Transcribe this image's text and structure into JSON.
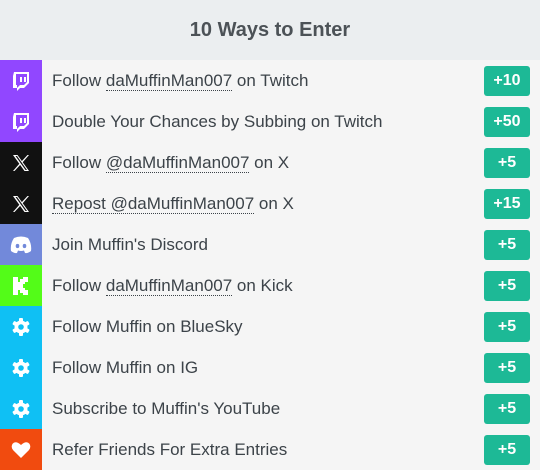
{
  "header": {
    "title": "10 Ways to Enter"
  },
  "colors": {
    "points_badge": "#1db996",
    "twitch": "#9147ff",
    "x": "#111111",
    "discord": "#7289da",
    "kick": "#53fc18",
    "bluesky": "#0fc0f4",
    "heart": "#f14b0f"
  },
  "entries": [
    {
      "label_pre": "Follow ",
      "label_link": "daMuffinMan007",
      "label_post": " on Twitch",
      "points": "+10",
      "icon": "twitch-icon"
    },
    {
      "label_pre": "Double Your Chances by Subbing on Twitch",
      "label_link": "",
      "label_post": "",
      "points": "+50",
      "icon": "twitch-icon"
    },
    {
      "label_pre": "Follow ",
      "label_link": "@daMuffinMan007",
      "label_post": " on X",
      "points": "+5",
      "icon": "x-icon"
    },
    {
      "label_pre": "",
      "label_link": "Repost @daMuffinMan007",
      "label_post": " on X",
      "points": "+15",
      "icon": "x-icon"
    },
    {
      "label_pre": "Join Muffin's Discord",
      "label_link": "",
      "label_post": "",
      "points": "+5",
      "icon": "discord-icon"
    },
    {
      "label_pre": "Follow ",
      "label_link": "daMuffinMan007",
      "label_post": " on Kick",
      "points": "+5",
      "icon": "kick-icon"
    },
    {
      "label_pre": "Follow Muffin on BlueSky",
      "label_link": "",
      "label_post": "",
      "points": "+5",
      "icon": "gear-icon"
    },
    {
      "label_pre": "Follow Muffin on IG",
      "label_link": "",
      "label_post": "",
      "points": "+5",
      "icon": "gear-icon"
    },
    {
      "label_pre": "Subscribe to Muffin's YouTube",
      "label_link": "",
      "label_post": "",
      "points": "+5",
      "icon": "gear-icon"
    },
    {
      "label_pre": "Refer Friends For Extra Entries",
      "label_link": "",
      "label_post": "",
      "points": "+5",
      "icon": "heart-icon"
    }
  ]
}
